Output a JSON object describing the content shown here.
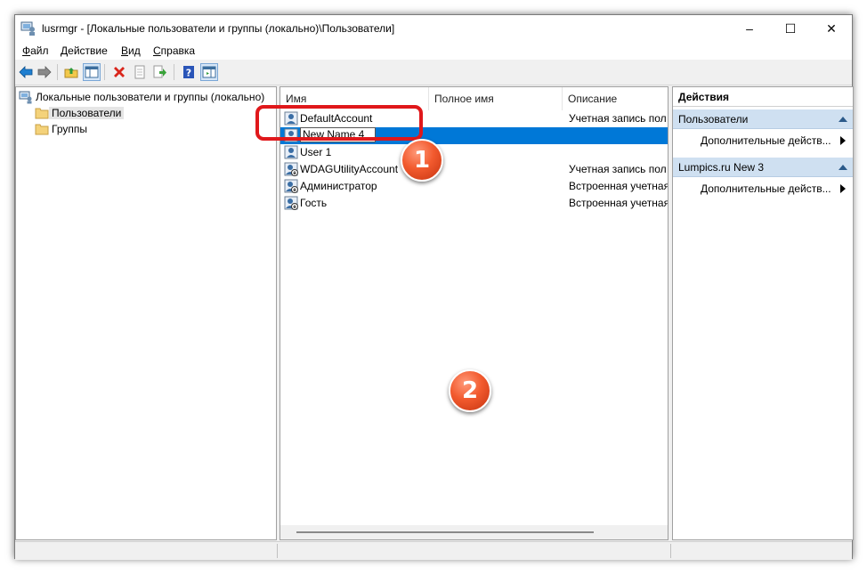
{
  "window": {
    "title": "lusrmgr - [Локальные пользователи и группы (локально)\\Пользователи]",
    "controls": {
      "minimize": "–",
      "maximize": "☐",
      "close": "✕"
    }
  },
  "menu": {
    "file": {
      "accel": "Ф",
      "rest": "айл"
    },
    "action": {
      "accel": "Д",
      "rest": "ействие"
    },
    "view": {
      "accel": "В",
      "rest": "ид"
    },
    "help": {
      "accel": "С",
      "rest": "правка"
    }
  },
  "toolbar": {
    "icons": [
      "back-arrow-icon",
      "forward-arrow-icon",
      "up-folder-icon",
      "show-hide-tree-icon",
      "delete-icon",
      "properties-icon",
      "export-list-icon",
      "help-icon",
      "show-hide-action-pane-icon"
    ]
  },
  "tree": {
    "root": "Локальные пользователи и группы (локально)",
    "items": [
      "Пользователи",
      "Группы"
    ]
  },
  "list": {
    "columns": {
      "name": "Имя",
      "fullname": "Полное имя",
      "description": "Описание"
    },
    "rows": [
      {
        "name": "DefaultAccount",
        "description": "Учетная запись пол"
      },
      {
        "name": "",
        "description": ""
      },
      {
        "name": "User 1",
        "description": ""
      },
      {
        "name": "WDAGUtilityAccount",
        "description": "Учетная запись пол"
      },
      {
        "name": "Администратор",
        "description": "Встроенная учетная"
      },
      {
        "name": "Гость",
        "description": "Встроенная учетная"
      }
    ],
    "edit_value": "New Name 4"
  },
  "actions": {
    "title": "Действия",
    "sections": [
      {
        "title": "Пользователи",
        "item": "Дополнительные действ..."
      },
      {
        "title": "Lumpics.ru New 3",
        "item": "Дополнительные действ..."
      }
    ]
  },
  "annotations": {
    "badge1": "1",
    "badge2": "2"
  },
  "colors": {
    "selection": "#0078d7",
    "highlight": "#e0181b",
    "badge": "#f25a2e",
    "action_section": "#cfe0f1"
  }
}
